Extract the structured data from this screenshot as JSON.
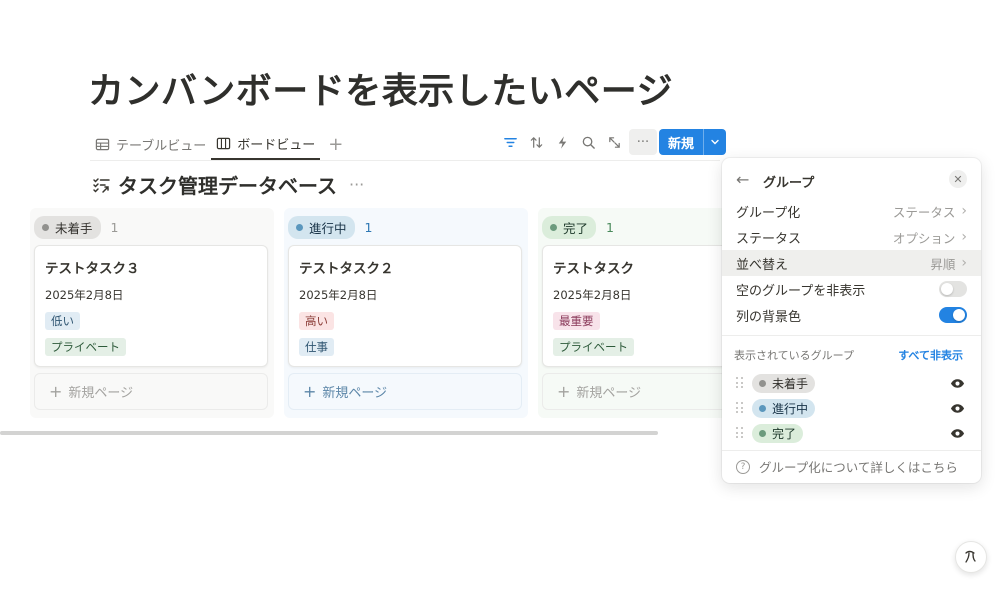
{
  "page": {
    "title": "カンバンボードを表示したいページ"
  },
  "views": {
    "tabs": [
      {
        "label": "テーブルビュー",
        "active": false
      },
      {
        "label": "ボードビュー",
        "active": true
      }
    ],
    "add": "+"
  },
  "toolbar": {
    "icons": [
      "filter-icon",
      "sort-icon",
      "automation-icon",
      "search-icon",
      "expand-icon",
      "more-icon"
    ],
    "more": "···",
    "new_label": "新規",
    "accent": "#2383e2"
  },
  "database": {
    "title": "タスク管理データベース",
    "more": "···"
  },
  "board": {
    "columns": [
      {
        "status": "未着手",
        "count": "1",
        "colors": {
          "bg": "#f9f9f8",
          "pill_bg": "#e3e2e0",
          "dot": "#91918e",
          "text": "#32302c",
          "count": "#9b9a97"
        },
        "card": {
          "title": "テストタスク３",
          "date": "2025年2月8日",
          "tags": [
            {
              "label": "低い",
              "bg": "#e1ecf4",
              "fg": "#2f5571"
            },
            {
              "label": "プライベート",
              "bg": "#e4efe6",
              "fg": "#2d5a3a"
            }
          ]
        },
        "new_page": "新規ページ"
      },
      {
        "status": "進行中",
        "count": "1",
        "colors": {
          "bg": "#f5f9fd",
          "pill_bg": "#d3e5ef",
          "dot": "#5b97bd",
          "text": "#183347",
          "count": "#2f78b4"
        },
        "card": {
          "title": "テストタスク２",
          "date": "2025年2月8日",
          "tags": [
            {
              "label": "高い",
              "bg": "#fbe4e4",
              "fg": "#8a3b36"
            },
            {
              "label": "仕事",
              "bg": "#e1ecf4",
              "fg": "#2f5571"
            }
          ]
        },
        "new_page": "新規ページ"
      },
      {
        "status": "完了",
        "count": "1",
        "colors": {
          "bg": "#f6faf6",
          "pill_bg": "#dbeddb",
          "dot": "#6c9b7d",
          "text": "#1c3829",
          "count": "#4a8a5c"
        },
        "card": {
          "title": "テストタスク",
          "date": "2025年2月8日",
          "tags": [
            {
              "label": "最重要",
              "bg": "#f8e3ea",
              "fg": "#8a3a5a"
            },
            {
              "label": "プライベート",
              "bg": "#e4efe6",
              "fg": "#2d5a3a"
            }
          ]
        },
        "new_page": "新規ページ"
      }
    ]
  },
  "group_panel": {
    "title": "グループ",
    "rows": [
      {
        "label": "グループ化",
        "value": "ステータス"
      },
      {
        "label": "ステータス",
        "value": "オプション"
      },
      {
        "label": "並べ替え",
        "value": "昇順"
      }
    ],
    "hide_empty": {
      "label": "空のグループを非表示",
      "on": false
    },
    "col_bg": {
      "label": "列の背景色",
      "on": true
    },
    "visible_groups_label": "表示されているグループ",
    "hide_all": "すべて非表示",
    "groups": [
      "未着手",
      "進行中",
      "完了"
    ],
    "help": "グループ化について詳しくはこちら"
  }
}
